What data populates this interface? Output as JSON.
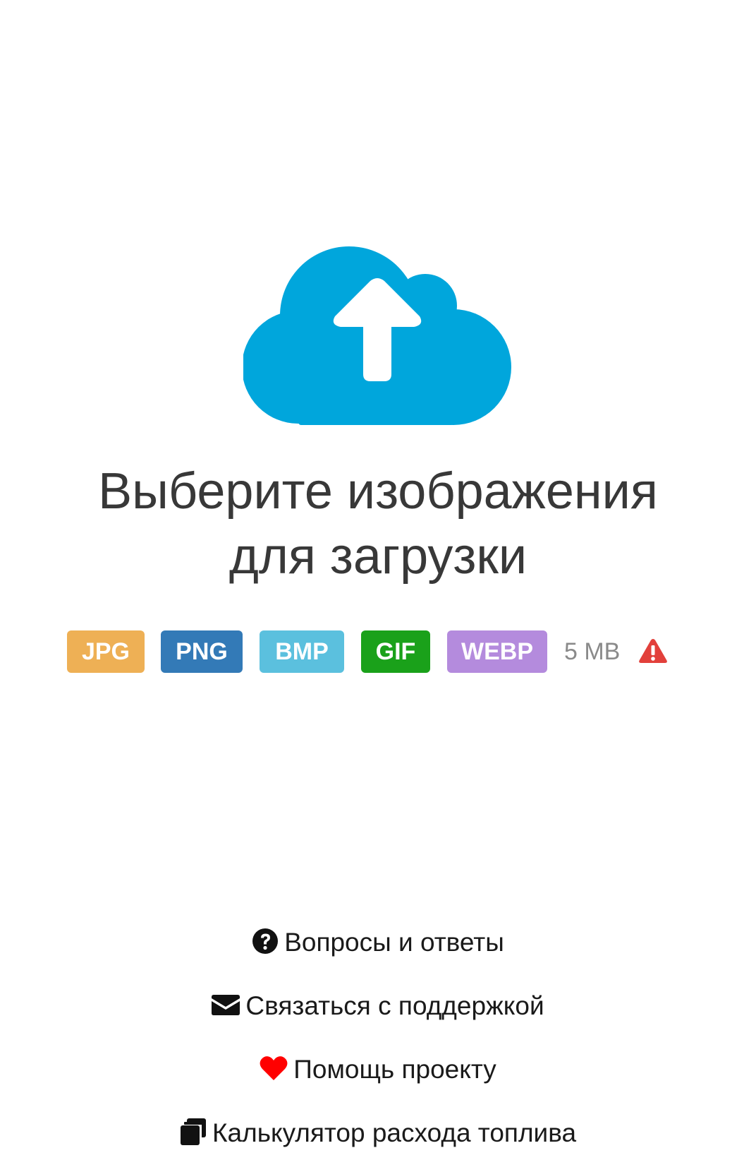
{
  "upload": {
    "title_line1": "Выберите изображения",
    "title_line2": "для загрузки",
    "icon": "cloud-upload-icon",
    "icon_color": "#00a6dc"
  },
  "formats": [
    {
      "label": "JPG",
      "color": "#eeb055"
    },
    {
      "label": "PNG",
      "color": "#337ab7"
    },
    {
      "label": "BMP",
      "color": "#5bc0de"
    },
    {
      "label": "GIF",
      "color": "#1aa11a"
    },
    {
      "label": "WEBP",
      "color": "#b48bdd"
    }
  ],
  "size_limit": "5 MB",
  "warning_icon": "warning-triangle-icon",
  "warning_color": "#e2403b",
  "footer": {
    "links": [
      {
        "label": "Вопросы и ответы",
        "icon": "question-circle-icon"
      },
      {
        "label": "Связаться с поддержкой",
        "icon": "envelope-icon"
      },
      {
        "label": "Помощь проекту",
        "icon": "heart-icon",
        "icon_color": "#ff0000"
      },
      {
        "label": "Калькулятор расхода топлива",
        "icon": "copy-icon"
      }
    ]
  }
}
